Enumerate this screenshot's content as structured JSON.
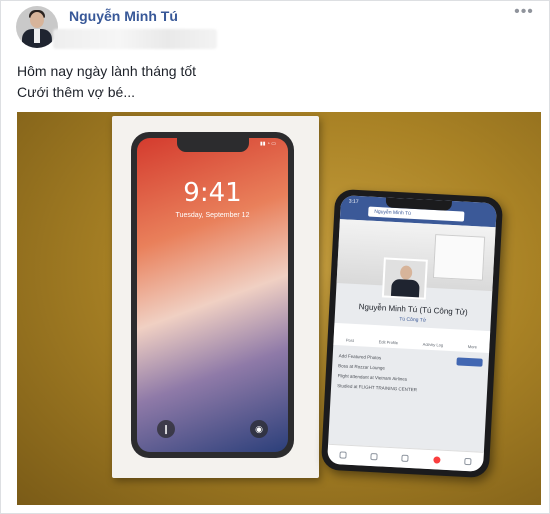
{
  "post": {
    "author": "Nguyễn Minh Tú",
    "more_icon": "more-horizontal-icon",
    "caption_lines": [
      "Hôm nay ngày lành tháng tốt",
      "Cưới thêm vợ bé..."
    ]
  },
  "photo": {
    "box_phone": {
      "time": "9:41",
      "date": "Tuesday, September 12"
    },
    "phone": {
      "status_time": "3:17",
      "search_text": "Nguyễn Minh Tú",
      "profile_name": "Nguyễn Minh Tú (Tú Công Tử)",
      "profile_sub": "Tú Công Tử",
      "actions": [
        "Post",
        "Edit Profile",
        "Activity Log",
        "More"
      ],
      "info_lines": [
        "Add Featured Photos",
        "Boss at Rozzar Lounge",
        "Flight attendant at Vietnam Airlines",
        "Studied at FLIGHT TRAINING CENTER"
      ]
    }
  }
}
